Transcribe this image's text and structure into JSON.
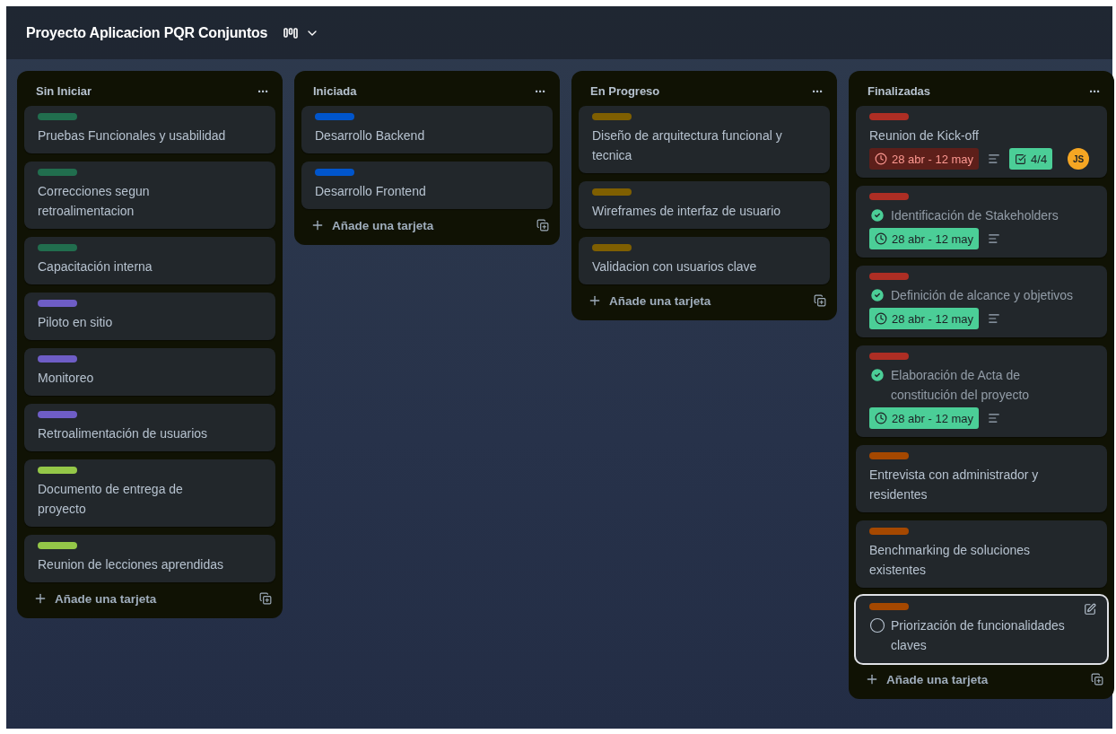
{
  "board": {
    "title": "Proyecto Aplicacion PQR Conjuntos"
  },
  "columns": [
    {
      "title": "Sin Iniciar",
      "menu": "···",
      "add_label": "Añade una tarjeta",
      "cards": [
        {
          "kind": "plain",
          "selected": false,
          "color": "#216e4e",
          "title": "Pruebas Funcionales y usabilidad"
        },
        {
          "kind": "plain",
          "selected": false,
          "color": "#216e4e",
          "title": "Correcciones segun retroalimentacion"
        },
        {
          "kind": "plain",
          "selected": false,
          "color": "#216e4e",
          "title": "Capacitación interna"
        },
        {
          "kind": "plain",
          "selected": false,
          "color": "#6e5dc6",
          "title": "Piloto en sitio"
        },
        {
          "kind": "plain",
          "selected": false,
          "color": "#6e5dc6",
          "title": "Monitoreo"
        },
        {
          "kind": "plain",
          "selected": false,
          "color": "#6e5dc6",
          "title": "Retroalimentación de usuarios"
        },
        {
          "kind": "plain",
          "selected": false,
          "color": "#94c748",
          "title": "Documento de entrega de proyecto"
        },
        {
          "kind": "plain",
          "selected": false,
          "color": "#94c748",
          "title": "Reunion de lecciones aprendidas"
        }
      ]
    },
    {
      "title": "Iniciada",
      "menu": "···",
      "add_label": "Añade una tarjeta",
      "cards": [
        {
          "kind": "plain",
          "selected": false,
          "color": "#0055cc",
          "title": "Desarrollo Backend"
        },
        {
          "kind": "plain",
          "selected": false,
          "color": "#0055cc",
          "title": "Desarrollo Frontend"
        }
      ]
    },
    {
      "title": "En Progreso",
      "menu": "···",
      "add_label": "Añade una tarjeta",
      "cards": [
        {
          "kind": "plain",
          "selected": false,
          "color": "#7f5f01",
          "title": "Diseño de arquitectura funcional y tecnica"
        },
        {
          "kind": "plain",
          "selected": false,
          "color": "#7f5f01",
          "title": "Wireframes de interfaz de usuario"
        },
        {
          "kind": "plain",
          "selected": false,
          "color": "#7f5f01",
          "title": "Validacion con usuarios clave"
        }
      ]
    },
    {
      "title": "Finalizadas",
      "menu": "···",
      "add_label": "Añade una tarjeta",
      "cards": [
        {
          "kind": "plain",
          "selected": false,
          "color": "#ae2e24",
          "title": "Reunion de Kick-off",
          "due": {
            "text": "28 abr - 12 may",
            "overdue": true
          },
          "description": true,
          "checklist": {
            "text": "4/4",
            "complete": true
          },
          "member": {
            "initials": "JS",
            "color": "#f5a623"
          }
        },
        {
          "kind": "task",
          "completed": true,
          "selected": false,
          "color": "#ae2e24",
          "title": "Identificación de Stakeholders",
          "due": {
            "text": "28 abr - 12 may",
            "overdue": false
          },
          "description": true
        },
        {
          "kind": "task",
          "completed": true,
          "selected": false,
          "color": "#ae2e24",
          "title": "Definición de alcance y objetivos",
          "due": {
            "text": "28 abr - 12 may",
            "overdue": false
          },
          "description": true
        },
        {
          "kind": "task",
          "completed": true,
          "selected": false,
          "color": "#ae2e24",
          "title": "Elaboración de Acta de constitución del proyecto",
          "due": {
            "text": "28 abr - 12 may",
            "overdue": false
          },
          "description": true
        },
        {
          "kind": "plain",
          "selected": false,
          "color": "#a54800",
          "title": "Entrevista con administrador y residentes"
        },
        {
          "kind": "plain",
          "selected": false,
          "color": "#a54800",
          "title": "Benchmarking de soluciones existentes"
        },
        {
          "kind": "task",
          "completed": false,
          "selected": true,
          "color": "#a54800",
          "title": "Priorización de funcionalidades claves"
        }
      ]
    }
  ]
}
